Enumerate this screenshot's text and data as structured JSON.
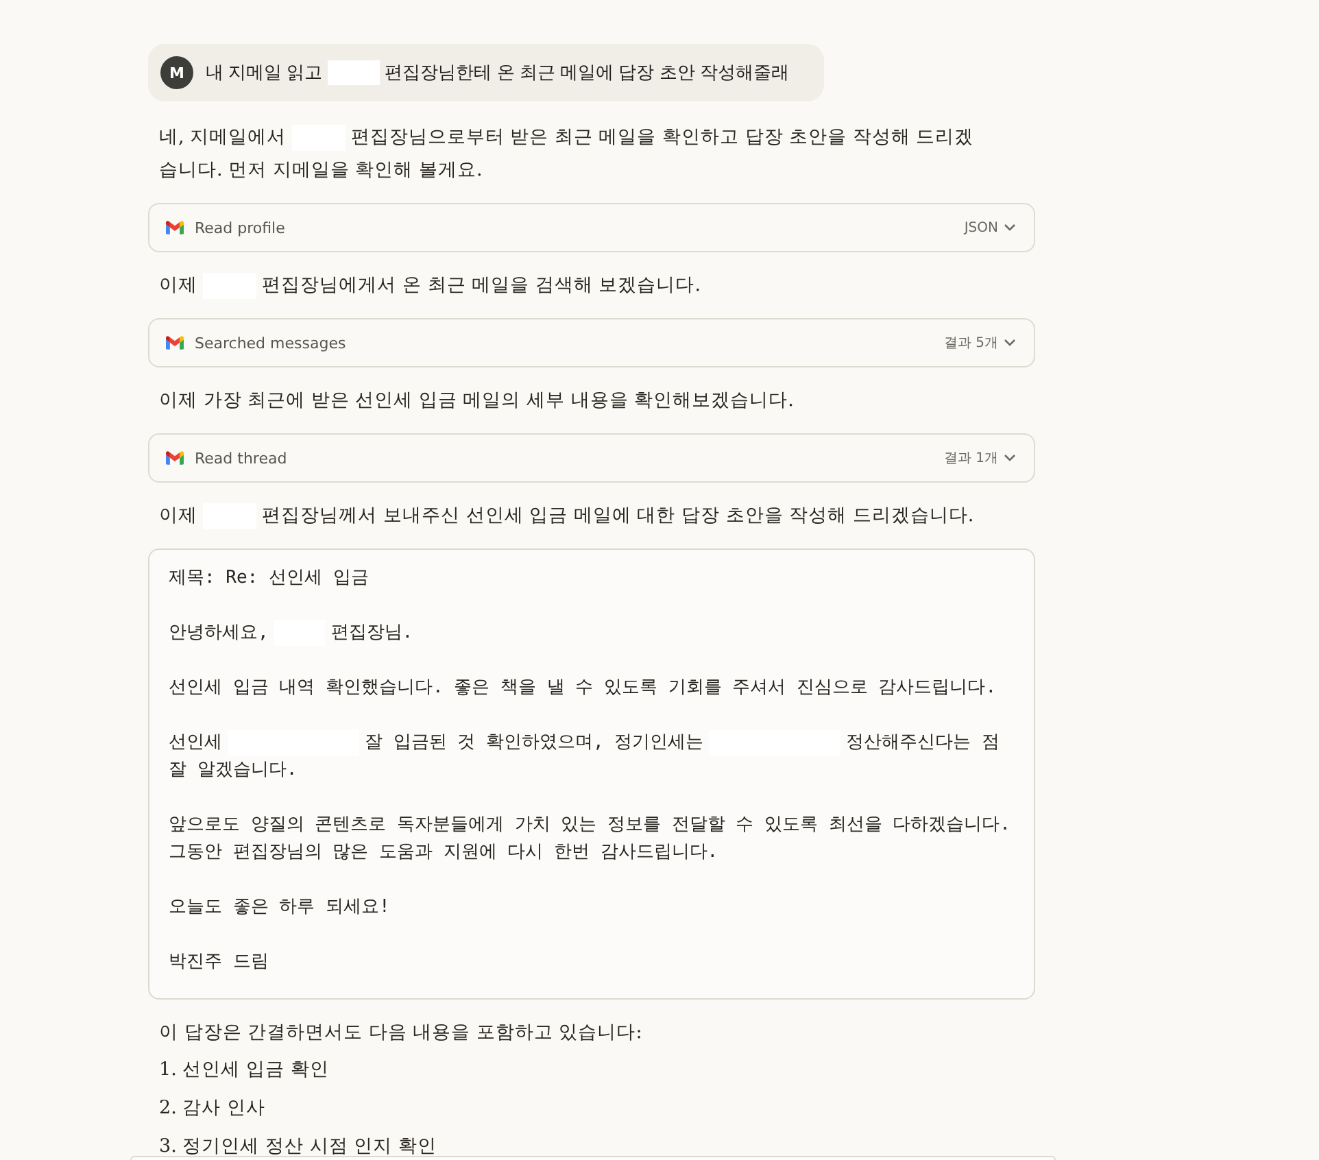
{
  "user_message": {
    "avatar": "M",
    "parts": [
      {
        "kind": "text",
        "text": "내 지메일 읽고"
      },
      {
        "kind": "redacted"
      },
      {
        "kind": "text",
        "text": "편집장님한테 온 최근 메일에 답장 초안 작성해줄래"
      }
    ]
  },
  "response": [
    {
      "kind": "paragraph",
      "parts": [
        {
          "kind": "text",
          "text": "네, 지메일에서"
        },
        {
          "kind": "redacted"
        },
        {
          "kind": "text",
          "text": "편집장님으로부터 받은 최근 메일을 확인하고 답장 초안을 작성해 드리겠습니다. 먼저 지메일을 확인해 볼게요."
        }
      ]
    },
    {
      "kind": "tool",
      "label": "Read profile",
      "result": "JSON",
      "expanded": false
    },
    {
      "kind": "paragraph",
      "parts": [
        {
          "kind": "text",
          "text": "이제"
        },
        {
          "kind": "redacted"
        },
        {
          "kind": "text",
          "text": "편집장님에게서 온 최근 메일을 검색해 보겠습니다."
        }
      ]
    },
    {
      "kind": "tool",
      "label": "Searched messages",
      "result": "결과 5개",
      "expanded": false
    },
    {
      "kind": "paragraph",
      "parts": [
        {
          "kind": "text",
          "text": "이제 가장 최근에 받은 선인세 입금 메일의 세부 내용을 확인해보겠습니다."
        }
      ]
    },
    {
      "kind": "tool",
      "label": "Read thread",
      "result": "결과 1개",
      "expanded": false
    },
    {
      "kind": "paragraph",
      "parts": [
        {
          "kind": "text",
          "text": "이제"
        },
        {
          "kind": "redacted"
        },
        {
          "kind": "text",
          "text": "편집장님께서 보내주신 선인세 입금 메일에 대한 답장 초안을 작성해 드리겠습니다."
        }
      ]
    },
    {
      "kind": "email",
      "subject": "제목: Re: 선인세 입금",
      "paragraphs": [
        {
          "parts": [
            {
              "kind": "text",
              "text": "안녕하세요,"
            },
            {
              "kind": "redacted"
            },
            {
              "kind": "text",
              "text": "편집장님."
            }
          ]
        },
        {
          "parts": [
            {
              "kind": "text",
              "text": "선인세 입금 내역 확인했습니다. 좋은 책을 낼 수 있도록 기회를 주셔서 진심으로 감사드립니다."
            }
          ]
        },
        {
          "parts": [
            {
              "kind": "text",
              "text": "선인세"
            },
            {
              "kind": "redacted_wide"
            },
            {
              "kind": "text",
              "text": "잘 입금된 것 확인하였으며, 정기인세는"
            },
            {
              "kind": "redacted_wide"
            },
            {
              "kind": "text",
              "text": "정산해주신다는 점 잘 알겠습니다."
            }
          ]
        },
        {
          "parts": [
            {
              "kind": "text",
              "text": "앞으로도 양질의 콘텐츠로 독자분들에게 가치 있는 정보를 전달할 수 있도록 최선을 다하겠습니다. 그동안 편집장님의 많은 도움과 지원에 다시 한번 감사드립니다."
            }
          ]
        },
        {
          "parts": [
            {
              "kind": "text",
              "text": "오늘도 좋은 하루 되세요!"
            }
          ]
        },
        {
          "parts": [
            {
              "kind": "text",
              "text": "박진주 드림"
            }
          ]
        }
      ]
    },
    {
      "kind": "paragraph",
      "parts": [
        {
          "kind": "text",
          "text": "이 답장은 간결하면서도 다음 내용을 포함하고 있습니다:"
        }
      ]
    },
    {
      "kind": "list",
      "items": [
        "1. 선인세 입금 확인",
        "2. 감사 인사",
        "3. 정기인세 정산 시점 인지 확인"
      ]
    }
  ]
}
